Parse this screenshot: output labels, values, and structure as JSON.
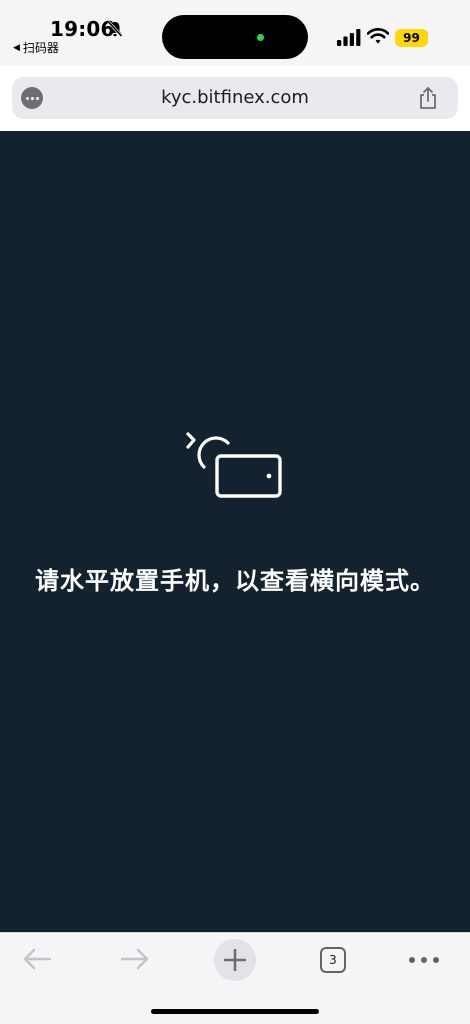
{
  "status_bar": {
    "time": "19:06",
    "back_app": "扫码器",
    "battery_level": "99",
    "icons": [
      "bell-muted-icon",
      "signal-icon",
      "wifi-icon",
      "battery-icon"
    ],
    "battery_color": "#ffd60a",
    "island_indicator_color": "#2ed158"
  },
  "address_bar": {
    "url": "kyc.bitfinex.com",
    "icons": [
      "page-menu-icon",
      "share-icon"
    ]
  },
  "content": {
    "background": "#142230",
    "icon": "rotate-device-icon",
    "message": "请水平放置手机，以查看横向模式。"
  },
  "toolbar": {
    "tab_count": "3",
    "icons": [
      "back-arrow-icon",
      "forward-arrow-icon",
      "plus-icon",
      "tabs-icon",
      "more-icon"
    ]
  }
}
